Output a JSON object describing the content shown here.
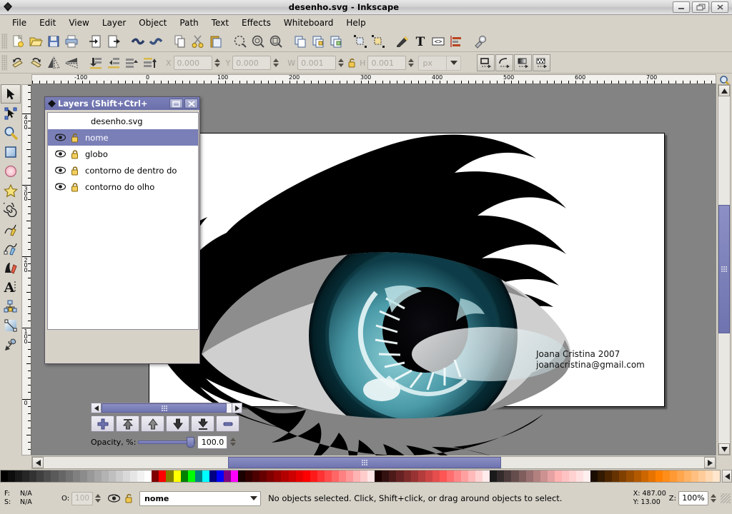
{
  "window": {
    "title": "desenho.svg - Inkscape",
    "minimize_label": "–",
    "restore_label": "❐",
    "close_label": "✕"
  },
  "menubar": {
    "items": [
      {
        "label": "File"
      },
      {
        "label": "Edit"
      },
      {
        "label": "View"
      },
      {
        "label": "Layer"
      },
      {
        "label": "Object"
      },
      {
        "label": "Path"
      },
      {
        "label": "Text"
      },
      {
        "label": "Effects"
      },
      {
        "label": "Whiteboard"
      },
      {
        "label": "Help"
      }
    ]
  },
  "commands_toolbar": {
    "buttons": [
      {
        "name": "new-document",
        "tooltip": "New"
      },
      {
        "name": "open-document",
        "tooltip": "Open"
      },
      {
        "name": "save-document",
        "tooltip": "Save"
      },
      {
        "name": "print-document",
        "tooltip": "Print"
      },
      {
        "name": "import-document",
        "tooltip": "Import"
      },
      {
        "name": "export-document",
        "tooltip": "Export"
      },
      {
        "name": "undo",
        "tooltip": "Undo"
      },
      {
        "name": "redo",
        "tooltip": "Redo"
      },
      {
        "name": "copy",
        "tooltip": "Copy"
      },
      {
        "name": "cut",
        "tooltip": "Cut"
      },
      {
        "name": "paste",
        "tooltip": "Paste"
      },
      {
        "name": "zoom-selection",
        "tooltip": "Zoom to selection"
      },
      {
        "name": "zoom-drawing",
        "tooltip": "Zoom to drawing"
      },
      {
        "name": "zoom-page",
        "tooltip": "Zoom to page"
      },
      {
        "name": "duplicate",
        "tooltip": "Duplicate"
      },
      {
        "name": "group",
        "tooltip": "Group"
      },
      {
        "name": "ungroup",
        "tooltip": "Ungroup"
      },
      {
        "name": "fill-stroke-dialog",
        "tooltip": "Fill and Stroke"
      },
      {
        "name": "object-properties",
        "tooltip": "Object properties"
      },
      {
        "name": "text-tool-dialog",
        "tooltip": "Text and Font"
      },
      {
        "name": "xml-editor",
        "tooltip": "XML Editor"
      },
      {
        "name": "align-distribute",
        "tooltip": "Align and Distribute"
      },
      {
        "name": "preferences",
        "tooltip": "Preferences"
      }
    ]
  },
  "tool_options_bar": {
    "buttons": [
      {
        "name": "rotate-90-ccw"
      },
      {
        "name": "rotate-90-cw"
      },
      {
        "name": "flip-horizontal"
      },
      {
        "name": "flip-vertical"
      },
      {
        "name": "lower-to-bottom"
      },
      {
        "name": "lower-one-step"
      },
      {
        "name": "raise-one-step"
      },
      {
        "name": "raise-to-top"
      }
    ],
    "x_label": "X",
    "x_value": "0.000",
    "y_label": "Y",
    "y_value": "0.000",
    "w_label": "W",
    "w_value": "0.001",
    "h_label": "H",
    "h_value": "0.001",
    "unit_value": "px",
    "lock_ratio_name": "lock-aspect-ratio",
    "affect_buttons": [
      {
        "name": "affect-stroke-width"
      },
      {
        "name": "affect-rounded-corners"
      },
      {
        "name": "affect-gradients"
      },
      {
        "name": "affect-patterns"
      }
    ]
  },
  "toolbox": {
    "tools": [
      {
        "name": "selector-tool",
        "active": true
      },
      {
        "name": "node-editor-tool",
        "active": false
      },
      {
        "name": "zoom-tool",
        "active": false
      },
      {
        "name": "rectangle-tool",
        "active": false
      },
      {
        "name": "ellipse-tool",
        "active": false
      },
      {
        "name": "star-tool",
        "active": false
      },
      {
        "name": "spiral-tool",
        "active": false
      },
      {
        "name": "pencil-tool",
        "active": false
      },
      {
        "name": "bezier-pen-tool",
        "active": false
      },
      {
        "name": "calligraphy-tool",
        "active": false
      },
      {
        "name": "text-tool",
        "active": false
      },
      {
        "name": "connector-tool",
        "active": false
      },
      {
        "name": "gradient-tool",
        "active": false
      },
      {
        "name": "dropper-tool",
        "active": false
      }
    ]
  },
  "rulers": {
    "horizontal_labels": [
      "-100",
      "0",
      "100",
      "200",
      "300",
      "400",
      "500",
      "600",
      "700"
    ],
    "vertical_labels": [
      "400",
      "300",
      "200",
      "100",
      "0"
    ]
  },
  "canvas": {
    "artwork_name": "eye-illustration",
    "signature_line1": "Joana Cristina 2007",
    "signature_line2": "joanacristina@gmail.com"
  },
  "layers_dialog": {
    "title": "Layers (Shift+Ctrl+",
    "document_name": "desenho.svg",
    "rows": [
      {
        "name": "nome",
        "selected": true,
        "visible": true,
        "locked": false
      },
      {
        "name": "globo",
        "selected": false,
        "visible": true,
        "locked": true
      },
      {
        "name": "contorno de dentro do",
        "selected": false,
        "visible": true,
        "locked": true
      },
      {
        "name": "contorno do olho",
        "selected": false,
        "visible": true,
        "locked": true
      }
    ],
    "buttons": [
      {
        "name": "new-layer-button",
        "glyph": "+"
      },
      {
        "name": "raise-layer-to-top-button",
        "glyph": "⇞"
      },
      {
        "name": "raise-layer-button",
        "glyph": "↑"
      },
      {
        "name": "lower-layer-button",
        "glyph": "↓"
      },
      {
        "name": "lower-layer-to-bottom-button",
        "glyph": "⇟"
      },
      {
        "name": "delete-layer-button",
        "glyph": "—"
      }
    ],
    "opacity_label": "Opacity, %:",
    "opacity_value": "100.0",
    "restore_label": "❐",
    "close_label": "✕"
  },
  "statusbar": {
    "fill_key": "F:",
    "fill_value": "N/A",
    "stroke_key": "S:",
    "stroke_value": "N/A",
    "opacity_key": "O:",
    "opacity_value": "100",
    "layer_name": "nome",
    "message": "No objects selected. Click, Shift+click, or drag around objects to select.",
    "coord_x": "X: 487.00",
    "coord_y": "Y: 13.00",
    "zoom_label": "Z:",
    "zoom_value": "100%"
  },
  "palette": {
    "name": "inkscape-default-palette",
    "colors": [
      "#000000",
      "#0d0d0d",
      "#1a1a1a",
      "#262626",
      "#333333",
      "#404040",
      "#4d4d4d",
      "#5a5a5a",
      "#666666",
      "#737373",
      "#808080",
      "#8c8c8c",
      "#999999",
      "#a6a6a6",
      "#b3b3b3",
      "#bfbfbf",
      "#cccccc",
      "#d9d9d9",
      "#e6e6e6",
      "#f2f2f2",
      "#ffffff",
      "#800000",
      "#ff0000",
      "#808000",
      "#ffff00",
      "#008000",
      "#00ff00",
      "#008080",
      "#00ffff",
      "#000080",
      "#0000ff",
      "#800080",
      "#ff00ff",
      "#1a0000",
      "#330000",
      "#4d0000",
      "#660000",
      "#800000",
      "#990000",
      "#b30000",
      "#cc0000",
      "#e60000",
      "#ff0000",
      "#ff1a1a",
      "#ff3333",
      "#ff4d4d",
      "#ff6666",
      "#ff8080",
      "#ff9999",
      "#ffb3b3",
      "#ffcccc",
      "#ffe6e6",
      "#1a0000",
      "#331111",
      "#4d1a1a",
      "#662222",
      "#802b2b",
      "#993333",
      "#b33c3c",
      "#cc4444",
      "#e64d4d",
      "#ff5555",
      "#ff6e6e",
      "#ff8787",
      "#ffa0a0",
      "#ffb9b9",
      "#ffd2d2",
      "#ffebeb",
      "#1a1a1a",
      "#332b2b",
      "#4d3c3c",
      "#664d4d",
      "#805e5e",
      "#996f6f",
      "#b38080",
      "#cc9191",
      "#e6a2a2",
      "#ffb3b3",
      "#ffc2c2",
      "#ffd1d1",
      "#ffe0e0",
      "#ffefef",
      "#1a0d00",
      "#331a00",
      "#4d2600",
      "#663300",
      "#804000",
      "#994d00",
      "#b35900",
      "#cc6600",
      "#e67300",
      "#ff8000",
      "#ff8d1a",
      "#ff9933",
      "#ffa64d",
      "#ffb366",
      "#ffbf80",
      "#ffcc99",
      "#ffd9b3",
      "#ffe6cc"
    ]
  },
  "scrollbars": {
    "vertical_name": "canvas-vertical-scrollbar",
    "horizontal_name": "canvas-horizontal-scrollbar"
  }
}
